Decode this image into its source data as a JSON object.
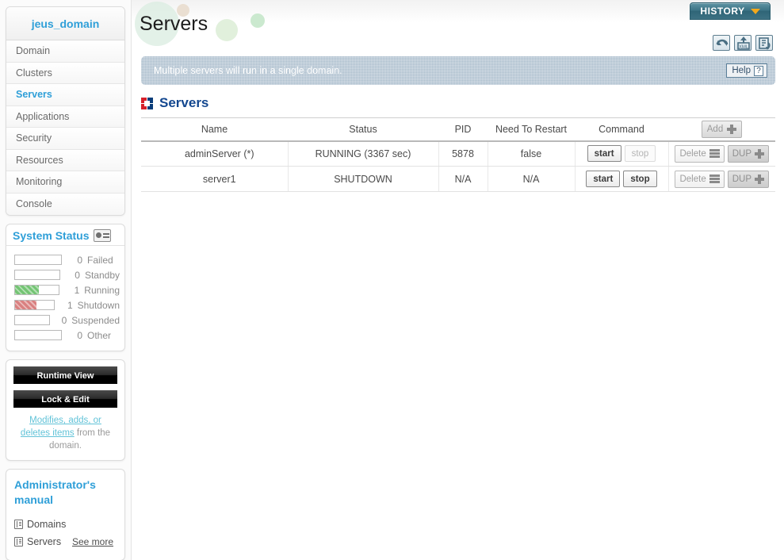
{
  "sidebar": {
    "domain_title": "jeus_domain",
    "nav": [
      {
        "label": "Domain",
        "active": false
      },
      {
        "label": "Clusters",
        "active": false
      },
      {
        "label": "Servers",
        "active": true
      },
      {
        "label": "Applications",
        "active": false
      },
      {
        "label": "Security",
        "active": false
      },
      {
        "label": "Resources",
        "active": false
      },
      {
        "label": "Monitoring",
        "active": false
      },
      {
        "label": "Console",
        "active": false
      }
    ],
    "system_status": {
      "title": "System Status",
      "icon": "monitor-icon",
      "rows": [
        {
          "count": "0",
          "label": "Failed",
          "fill": 0,
          "color": "none"
        },
        {
          "count": "0",
          "label": "Standby",
          "fill": 0,
          "color": "none"
        },
        {
          "count": "1",
          "label": "Running",
          "fill": 55,
          "color": "green"
        },
        {
          "count": "1",
          "label": "Shutdown",
          "fill": 55,
          "color": "red"
        },
        {
          "count": "0",
          "label": "Suspended",
          "fill": 0,
          "color": "none"
        },
        {
          "count": "0",
          "label": "Other",
          "fill": 0,
          "color": "none"
        }
      ],
      "colors": {
        "green": "#73c473",
        "red": "#d98080"
      }
    },
    "actions": {
      "runtime_view": "Runtime View",
      "lock_and_edit": "Lock & Edit",
      "note_link": "Modifies, adds, or deletes items",
      "note_rest": " from the domain."
    },
    "manual": {
      "title": "Administrator's manual",
      "items": [
        {
          "label": "Domains",
          "icon": "book-icon"
        },
        {
          "label": "Servers",
          "icon": "book-icon"
        }
      ],
      "see_more": "See more"
    }
  },
  "header": {
    "page_title": "Servers",
    "history_button": "HISTORY",
    "history_chevron": "chevron-down-icon",
    "toolbar_icons": [
      "refresh-icon",
      "xml-export-icon",
      "reload-config-icon"
    ]
  },
  "banner": {
    "message": "Multiple servers will run in a single domain.",
    "help_label": "Help",
    "help_glyph": "?"
  },
  "section": {
    "icon": "pinwheel-icon",
    "title": "Servers"
  },
  "table": {
    "columns": [
      "Name",
      "Status",
      "PID",
      "Need To Restart",
      "Command"
    ],
    "add_button": {
      "label": "Add",
      "icon": "plus-icon",
      "disabled": true
    },
    "rows": [
      {
        "name": "adminServer (*)",
        "status": "RUNNING (3367 sec)",
        "pid": "5878",
        "need_to_restart": "false",
        "start_label": "start",
        "stop_label": "stop",
        "stop_enabled": false,
        "delete_label": "Delete",
        "dup_label": "DUP"
      },
      {
        "name": "server1",
        "status": "SHUTDOWN",
        "pid": "N/A",
        "need_to_restart": "N/A",
        "start_label": "start",
        "stop_label": "stop",
        "stop_enabled": true,
        "delete_label": "Delete",
        "dup_label": "DUP"
      }
    ]
  },
  "colors": {
    "accent_blue": "#2f9fd8",
    "section_blue": "#13478f",
    "banner_bg": "#a9bccc",
    "history_teal": "#3d7486",
    "chevron_orange": "#f3a81c",
    "running_green": "#73c473",
    "shutdown_red": "#d98080"
  }
}
